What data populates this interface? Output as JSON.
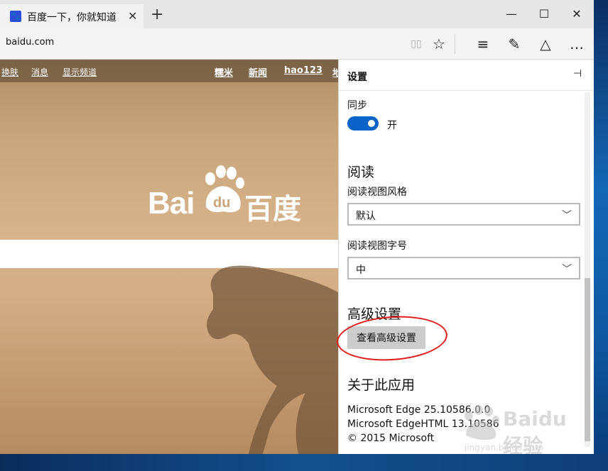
{
  "tab": {
    "title": "百度一下，你就知道",
    "close": "✕",
    "new_tab": "+"
  },
  "window": {
    "minimize": "—",
    "maximize": "☐",
    "close": "✕"
  },
  "address": {
    "url": "baidu.com"
  },
  "toolbar": {
    "reading_view": "▯▯",
    "favorite": "☆",
    "hub": "≡",
    "note": "✎",
    "share": "△",
    "more": "…"
  },
  "page": {
    "nav_left": [
      "换肤",
      "消息",
      "显示频道"
    ],
    "nav_right": [
      "糯米",
      "新闻",
      "hao123",
      "地"
    ],
    "logo_latin": "Bai",
    "logo_du": "du",
    "logo_cn": "百度"
  },
  "settings": {
    "title": "设置",
    "pin": "⊣",
    "sync_label": "同步",
    "sync_state": "开",
    "reading_section": "阅读",
    "reading_style_label": "阅读视图风格",
    "reading_style_value": "默认",
    "reading_font_label": "阅读视图字号",
    "reading_font_value": "中",
    "advanced_section": "高级设置",
    "advanced_button": "查看高级设置",
    "about_section": "关于此应用",
    "about_lines": [
      "Microsoft Edge 25.10586.0.0",
      "Microsoft EdgeHTML 13.10586",
      "© 2015 Microsoft"
    ]
  },
  "watermark": {
    "brand": "Baidu 经验",
    "url": "jingyan.baidu.com"
  },
  "colors": {
    "accent": "#0a63c9",
    "annotation": "#e01818",
    "button_bg": "#cccccc"
  }
}
